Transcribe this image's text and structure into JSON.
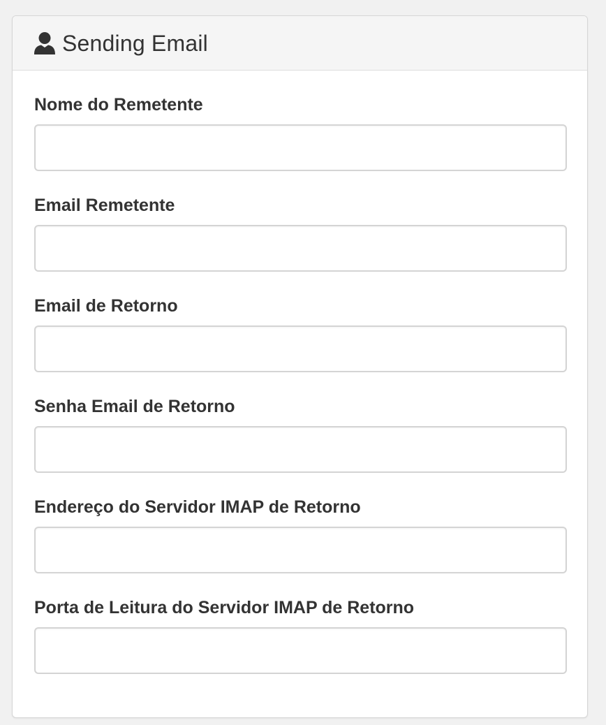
{
  "panel": {
    "title": "Sending Email",
    "icon": "user-icon"
  },
  "form": {
    "fields": [
      {
        "label": "Nome do Remetente",
        "value": "",
        "placeholder": ""
      },
      {
        "label": "Email Remetente",
        "value": "",
        "placeholder": ""
      },
      {
        "label": "Email de Retorno",
        "value": "",
        "placeholder": ""
      },
      {
        "label": "Senha Email de Retorno",
        "value": "",
        "placeholder": ""
      },
      {
        "label": "Endereço do Servidor IMAP de Retorno",
        "value": "",
        "placeholder": ""
      },
      {
        "label": "Porta de Leitura do Servidor IMAP de Retorno",
        "value": "",
        "placeholder": ""
      }
    ]
  },
  "colors": {
    "page_background": "#f1f1f1",
    "panel_header_background": "#f5f5f5",
    "text": "#333333",
    "input_border": "#d4d4d4"
  }
}
